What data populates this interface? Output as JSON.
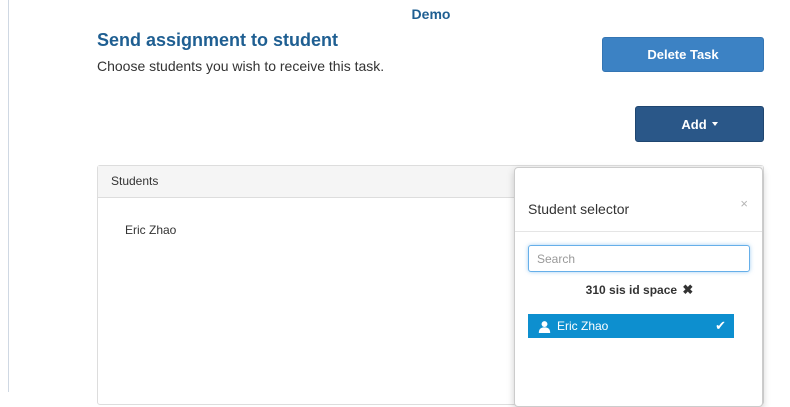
{
  "app": {
    "title": "Demo"
  },
  "page": {
    "heading": "Send assignment to student",
    "subheading": "Choose students you wish to receive this task."
  },
  "toolbar": {
    "delete_label": "Delete Task",
    "add_label": "Add"
  },
  "students_panel": {
    "header": "Students",
    "rows": [
      "Eric Zhao"
    ]
  },
  "selector": {
    "title": "Student selector",
    "close_glyph": "×",
    "search_placeholder": "Search",
    "search_value": "",
    "group_label": "310 sis id space",
    "group_remove_glyph": "✖",
    "items": [
      {
        "label": "Eric Zhao",
        "selected": true,
        "check_glyph": "✔"
      }
    ]
  },
  "colors": {
    "brand_blue": "#1f5f92",
    "delete_button": "#3c82c4",
    "add_button": "#2a5788",
    "selected_item": "#0d8fcf"
  },
  "icons": {
    "person": "user-icon",
    "check": "check-icon",
    "close": "close-icon",
    "remove": "remove-icon",
    "caret": "caret-down-icon"
  }
}
